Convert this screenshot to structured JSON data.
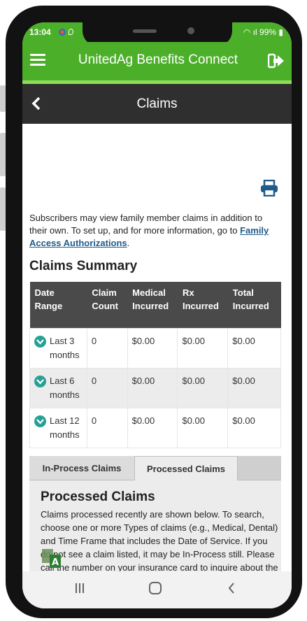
{
  "status_bar": {
    "time": "13:04",
    "battery": "99%"
  },
  "app_bar": {
    "title": "UnitedAg Benefits Connect",
    "menu_icon": "hamburger-menu-icon",
    "logout_icon": "logout-icon",
    "color": "#4caf2a"
  },
  "sub_header": {
    "title": "Claims",
    "back_icon": "chevron-left-icon",
    "color": "#2f2f2f"
  },
  "intro": {
    "text": "Subscribers may view family member claims in addition to their own. To set up, and for more information, go to ",
    "link": "Family Access Authorizations",
    "suffix": "."
  },
  "summary": {
    "title": "Claims Summary",
    "columns": [
      "Date Range",
      "Claim Count",
      "Medical Incurred",
      "Rx Incurred",
      "Total Incurred"
    ],
    "rows": [
      {
        "range": "Last 3 months",
        "count": "0",
        "medical": "$0.00",
        "rx": "$0.00",
        "total": "$0.00"
      },
      {
        "range": "Last 6 months",
        "count": "0",
        "medical": "$0.00",
        "rx": "$0.00",
        "total": "$0.00"
      },
      {
        "range": "Last 12 months",
        "count": "0",
        "medical": "$0.00",
        "rx": "$0.00",
        "total": "$0.00"
      }
    ]
  },
  "tabs": {
    "items": [
      "In-Process Claims",
      "Processed Claims"
    ],
    "active": "Processed Claims"
  },
  "panel": {
    "title": "Processed Claims",
    "text": "Claims processed recently are shown below. To search, choose one or more Types of claims (e.g., Medical, Dental) and Time Frame that includes the Date of Service. If you do not see a claim listed, it may be In-Process still. Please call the number on your insurance card to inquire about the status of a"
  },
  "accent_color": "#27a095"
}
